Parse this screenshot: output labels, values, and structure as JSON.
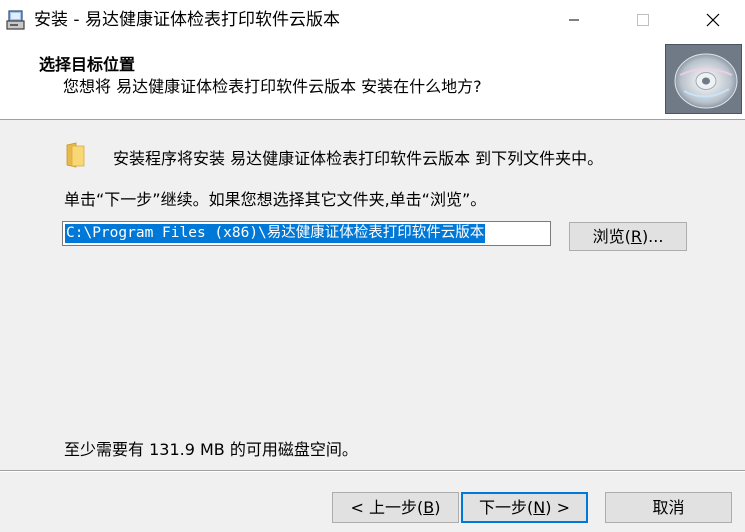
{
  "window": {
    "title": "安装 - 易达健康证体检表打印软件云版本"
  },
  "header": {
    "title": "选择目标位置",
    "subtitle": "您想将 易达健康证体检表打印软件云版本 安装在什么地方?"
  },
  "body": {
    "install_line": "安装程序将安装 易达健康证体检表打印软件云版本 到下列文件夹中。",
    "instruction": "单击“下一步”继续。如果您想选择其它文件夹,单击“浏览”。",
    "path_value": "C:\\Program Files (x86)\\易达健康证体检表打印软件云版本",
    "browse": {
      "pre": "浏览(",
      "key": "R",
      "post": ")..."
    },
    "space_required": "至少需要有 131.9 MB 的可用磁盘空间。"
  },
  "footer": {
    "back": {
      "pre": "< 上一步(",
      "key": "B",
      "post": ")"
    },
    "next": {
      "pre": "下一步(",
      "key": "N",
      "post": ") >"
    },
    "cancel": "取消"
  },
  "colors": {
    "selection": "#0078d7",
    "button_face": "#e1e1e1",
    "default_border": "#0078d7"
  }
}
